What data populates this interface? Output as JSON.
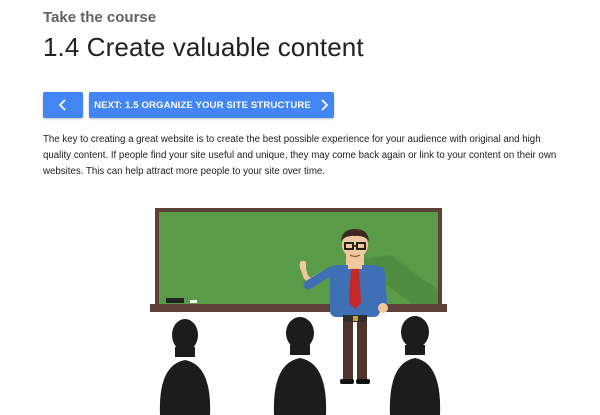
{
  "header": {
    "eyebrow": "Take the course",
    "title": "1.4 Create valuable content"
  },
  "nav": {
    "prev_icon": "chevron-left-icon",
    "next_label": "NEXT: 1.5 ORGANIZE YOUR SITE STRUCTURE",
    "next_icon": "chevron-right-icon"
  },
  "content": {
    "paragraph": "The key to creating a great website is to create the best possible experience for your audience with original and high quality content. If people find your site useful and unique, they may come back again or link to your content on their own websites. This can help attract more people to your site over time."
  },
  "colors": {
    "accent": "#4285f4",
    "board": "#5a9b48",
    "board_frame": "#5d4037",
    "shirt": "#3f6fb5",
    "tie": "#c62828",
    "silhouette": "#1c1c1c"
  }
}
